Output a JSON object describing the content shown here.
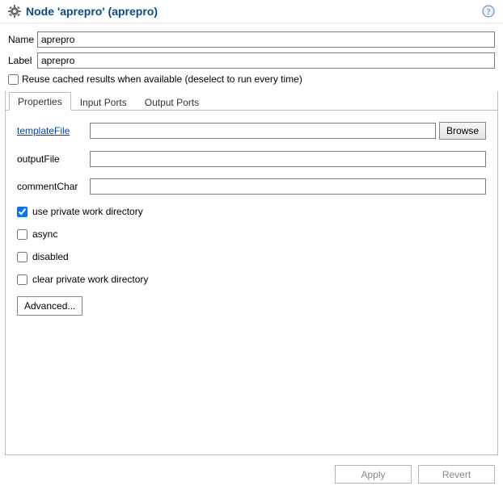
{
  "header": {
    "title": "Node 'aprepro' (aprepro)"
  },
  "fields": {
    "name_label": "Name",
    "name_value": "aprepro",
    "label_label": "Label",
    "label_value": "aprepro",
    "reuse_label": "Reuse cached results when available (deselect to run every time)",
    "reuse_checked": false
  },
  "tabs": {
    "properties": "Properties",
    "input": "Input Ports",
    "output": "Output Ports"
  },
  "properties": {
    "templateFile": {
      "label": "templateFile",
      "value": "",
      "browse": "Browse"
    },
    "outputFile": {
      "label": "outputFile",
      "value": ""
    },
    "commentChar": {
      "label": "commentChar",
      "value": ""
    },
    "usePrivate": {
      "label": "use private work directory",
      "checked": true
    },
    "async": {
      "label": "async",
      "checked": false
    },
    "disabled": {
      "label": "disabled",
      "checked": false
    },
    "clearPrivate": {
      "label": "clear private work directory",
      "checked": false
    },
    "advanced": "Advanced..."
  },
  "footer": {
    "apply": "Apply",
    "revert": "Revert"
  }
}
